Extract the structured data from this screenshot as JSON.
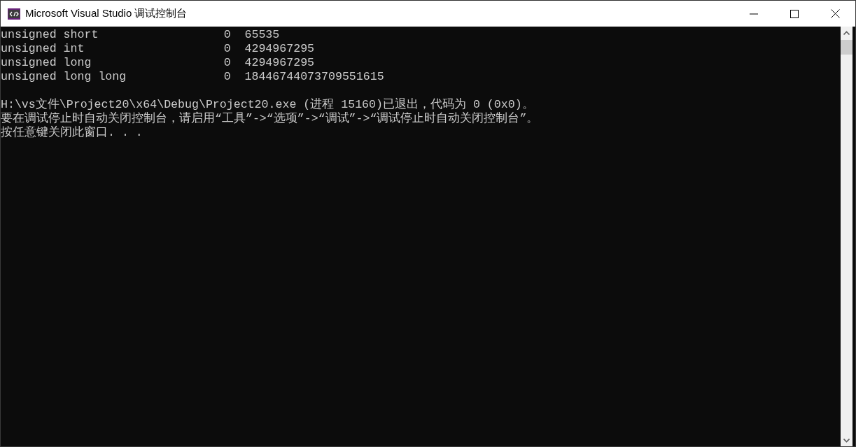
{
  "window": {
    "title": "Microsoft Visual Studio 调试控制台"
  },
  "console": {
    "table_rows": [
      {
        "type": "unsigned short",
        "min": "0",
        "max": "65535"
      },
      {
        "type": "unsigned int",
        "min": "0",
        "max": "4294967295"
      },
      {
        "type": "unsigned long",
        "min": "0",
        "max": "4294967295"
      },
      {
        "type": "unsigned long long",
        "min": "0",
        "max": "18446744073709551615"
      }
    ],
    "messages": [
      "H:\\vs文件\\Project20\\x64\\Debug\\Project20.exe (进程 15160)已退出，代码为 0 (0x0)。",
      "要在调试停止时自动关闭控制台，请启用“工具”->“选项”->“调试”->“调试停止时自动关闭控制台”。",
      "按任意键关闭此窗口. . ."
    ]
  }
}
